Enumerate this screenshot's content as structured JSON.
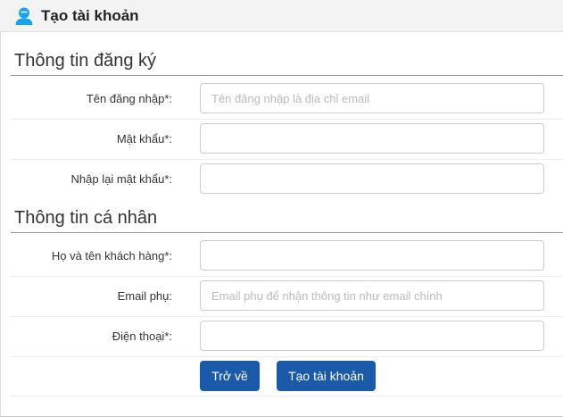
{
  "header": {
    "title": "Tạo tài khoản",
    "icon": "user-icon",
    "icon_color": "#1aa3e8"
  },
  "account_section": {
    "title": "Thông tin đăng ký",
    "fields": [
      {
        "label": "Tên đăng nhập*:",
        "value": "",
        "placeholder": "Tên đăng nhập là địa chỉ email"
      },
      {
        "label": "Mật khẩu*:",
        "value": "",
        "placeholder": ""
      },
      {
        "label": "Nhập lại mật khẩu*:",
        "value": "",
        "placeholder": ""
      }
    ]
  },
  "personal_section": {
    "title": "Thông tin cá nhân",
    "fields": [
      {
        "label": "Họ và tên khách hàng*:",
        "value": "",
        "placeholder": ""
      },
      {
        "label": "Email phụ:",
        "value": "",
        "placeholder": "Email phụ để nhận thông tin như email chính"
      },
      {
        "label": "Điện thoại*:",
        "value": "",
        "placeholder": ""
      }
    ]
  },
  "actions": {
    "back_label": "Trở về",
    "create_label": "Tạo tài khoản",
    "button_color": "#1a5aa8"
  }
}
